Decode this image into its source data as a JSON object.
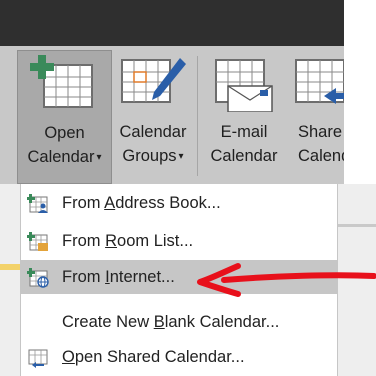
{
  "ribbon": {
    "buttons": [
      {
        "line1": "Open",
        "line2": "Calendar",
        "has_dropdown": true,
        "active": true
      },
      {
        "line1": "Calendar",
        "line2": "Groups",
        "has_dropdown": true,
        "active": false
      },
      {
        "line1": "E-mail",
        "line2": "Calendar",
        "has_dropdown": false,
        "active": false
      },
      {
        "line1": "Share",
        "line2": "Calend",
        "has_dropdown": false,
        "active": false
      }
    ]
  },
  "menu": {
    "items": [
      {
        "pre": "From ",
        "key": "A",
        "post": "ddress Book...",
        "icon": "address-book-calendar-icon",
        "highlighted": false
      },
      {
        "pre": "From ",
        "key": "R",
        "post": "oom List...",
        "icon": "room-list-calendar-icon",
        "highlighted": false
      },
      {
        "pre": "From ",
        "key": "I",
        "post": "nternet...",
        "icon": "internet-calendar-icon",
        "highlighted": true
      },
      {
        "pre": "Create New ",
        "key": "B",
        "post": "lank Calendar...",
        "icon": "",
        "highlighted": false
      },
      {
        "pre": "",
        "key": "O",
        "post": "pen Shared Calendar...",
        "icon": "shared-calendar-icon",
        "highlighted": false
      }
    ]
  },
  "colors": {
    "ribbon_bg": "#c8c8c8",
    "titlebar": "#2f2f2f",
    "highlight": "#c6c6c6",
    "annotation_arrow": "#e8101b",
    "accent_blue": "#2a5ea8",
    "accent_green": "#3a8a5a"
  }
}
